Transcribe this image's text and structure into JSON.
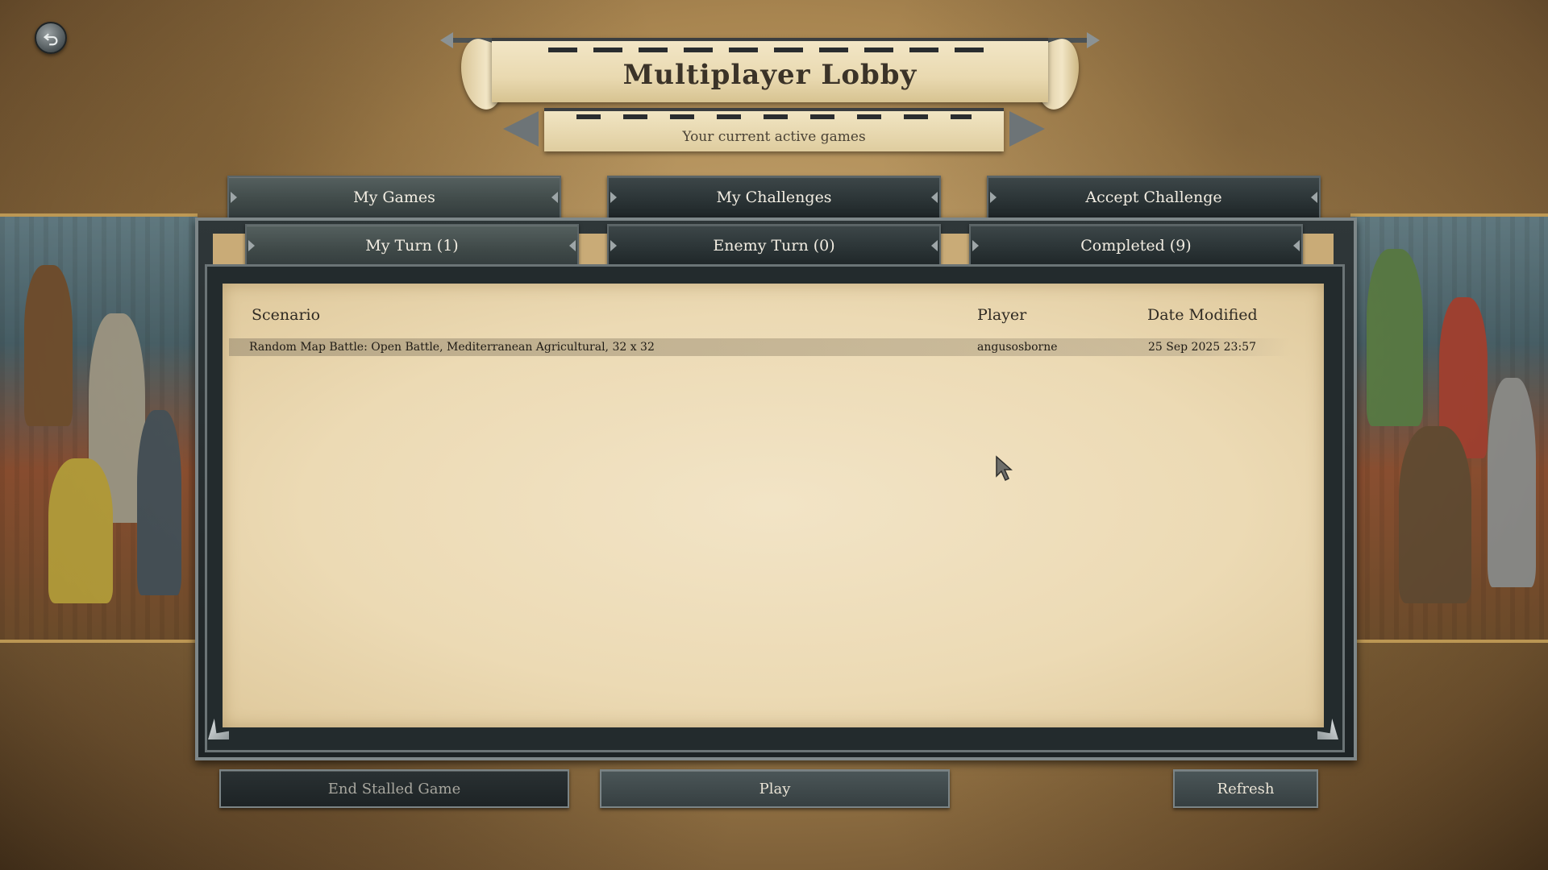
{
  "header": {
    "title": "Multiplayer Lobby",
    "subtitle": "Your current active games"
  },
  "tabs": [
    {
      "label": "My Games",
      "active": true
    },
    {
      "label": "My Challenges",
      "active": false
    },
    {
      "label": "Accept Challenge",
      "active": false
    }
  ],
  "subtabs": [
    {
      "label": "My Turn (1)",
      "active": true
    },
    {
      "label": "Enemy Turn (0)",
      "active": false
    },
    {
      "label": "Completed (9)",
      "active": false
    }
  ],
  "table": {
    "columns": [
      "Scenario",
      "Player",
      "Date Modified"
    ],
    "rows": [
      {
        "scenario": "Random Map Battle: Open Battle, Mediterranean Agricultural, 32 x 32",
        "player": "angusosborne",
        "date_modified": "25 Sep 2025 23:57"
      }
    ]
  },
  "buttons": {
    "end_stalled": "End Stalled Game",
    "play": "Play",
    "refresh": "Refresh"
  },
  "icons": {
    "back": "back-arrow-icon",
    "prev": "arrow-left-icon",
    "next": "arrow-right-icon",
    "cursor": "mouse-cursor-icon"
  },
  "colors": {
    "button_dark": "#363f41",
    "parchment": "#ecdab4",
    "frame": "#7e8789"
  }
}
